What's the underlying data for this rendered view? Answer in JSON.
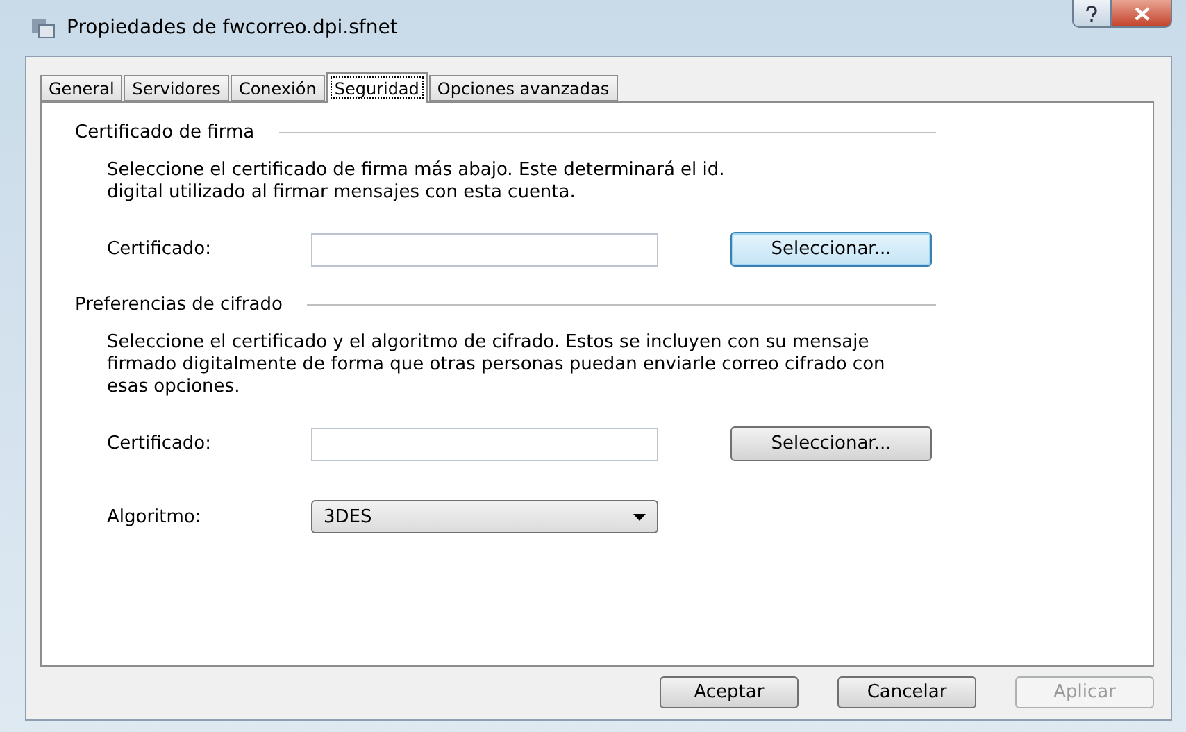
{
  "window": {
    "title": "Propiedades de fwcorreo.dpi.sfnet"
  },
  "tabs": [
    {
      "label": "General",
      "selected": false
    },
    {
      "label": "Servidores",
      "selected": false
    },
    {
      "label": "Conexión",
      "selected": false
    },
    {
      "label": "Seguridad",
      "selected": true
    },
    {
      "label": "Opciones avanzadas",
      "selected": false
    }
  ],
  "sections": [
    {
      "title": "Certificado de firma",
      "description": "Seleccione el certificado de firma más abajo. Este determinará el id. digital utilizado al firmar mensajes con esta cuenta.",
      "fields": [
        {
          "kind": "text",
          "label": "Certificado:",
          "button": "Seleccionar...",
          "button_default": true
        }
      ]
    },
    {
      "title": "Preferencias de cifrado",
      "description": "Seleccione el certificado y el algoritmo de cifrado. Estos se incluyen con su mensaje firmado digitalmente de forma que otras personas puedan enviarle correo cifrado con esas opciones.",
      "fields": [
        {
          "kind": "text",
          "label": "Certificado:",
          "button": "Seleccionar...",
          "button_default": false
        },
        {
          "kind": "select",
          "label": "Algoritmo:",
          "value": "3DES"
        }
      ]
    }
  ],
  "buttons": [
    {
      "label": "Aceptar",
      "disabled": false
    },
    {
      "label": "Cancelar",
      "disabled": false
    },
    {
      "label": "Aplicar",
      "disabled": true
    }
  ]
}
